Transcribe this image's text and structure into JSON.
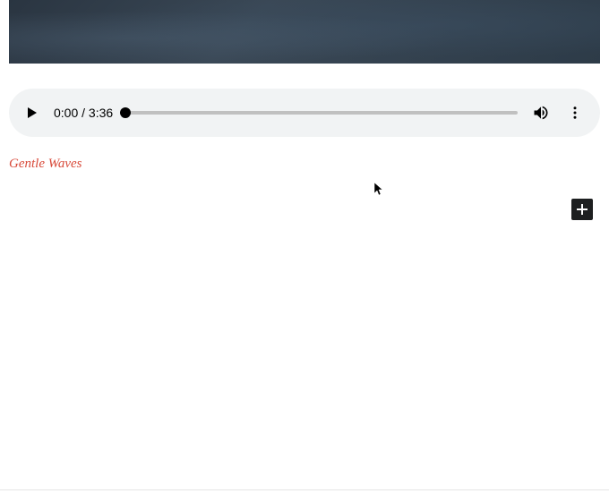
{
  "audio": {
    "current_time": "0:00",
    "duration": "3:36",
    "separator": " / "
  },
  "caption": "Gentle Waves",
  "icons": {
    "play": "play-icon",
    "volume": "volume-icon",
    "more": "more-vertical-icon",
    "add": "plus-icon"
  }
}
